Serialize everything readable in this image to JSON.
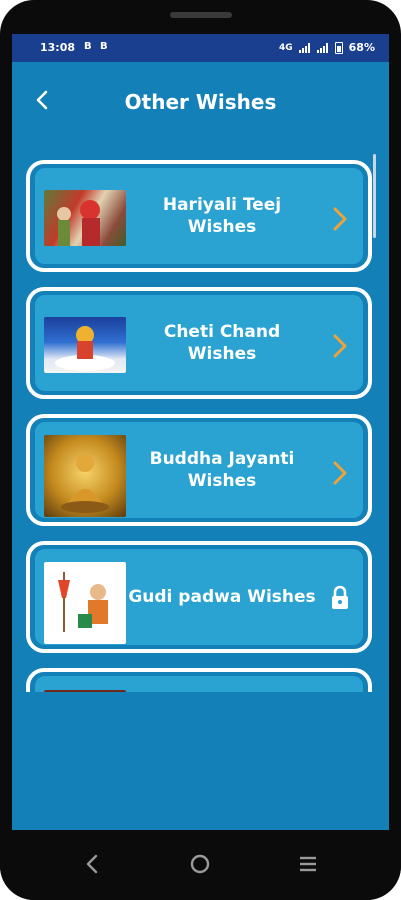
{
  "status_bar": {
    "time": "13:08",
    "left_icons": [
      "B",
      "B"
    ],
    "network_label": "4G",
    "battery": "68%"
  },
  "header": {
    "title": "Other Wishes",
    "back_icon": "back-chevron-icon"
  },
  "items": [
    {
      "label": "Hariyali Teej Wishes",
      "action_icon": "chevron-right-icon",
      "locked": false
    },
    {
      "label": "Cheti Chand Wishes",
      "action_icon": "chevron-right-icon",
      "locked": false
    },
    {
      "label": "Buddha Jayanti Wishes",
      "action_icon": "chevron-right-icon",
      "locked": false
    },
    {
      "label": "Gudi padwa Wishes",
      "action_icon": "lock-icon",
      "locked": true
    }
  ],
  "colors": {
    "background": "#1380b8",
    "card": "#2aa3d2",
    "status_bar": "#1a3f8f",
    "chevron": "#f0a23a"
  }
}
